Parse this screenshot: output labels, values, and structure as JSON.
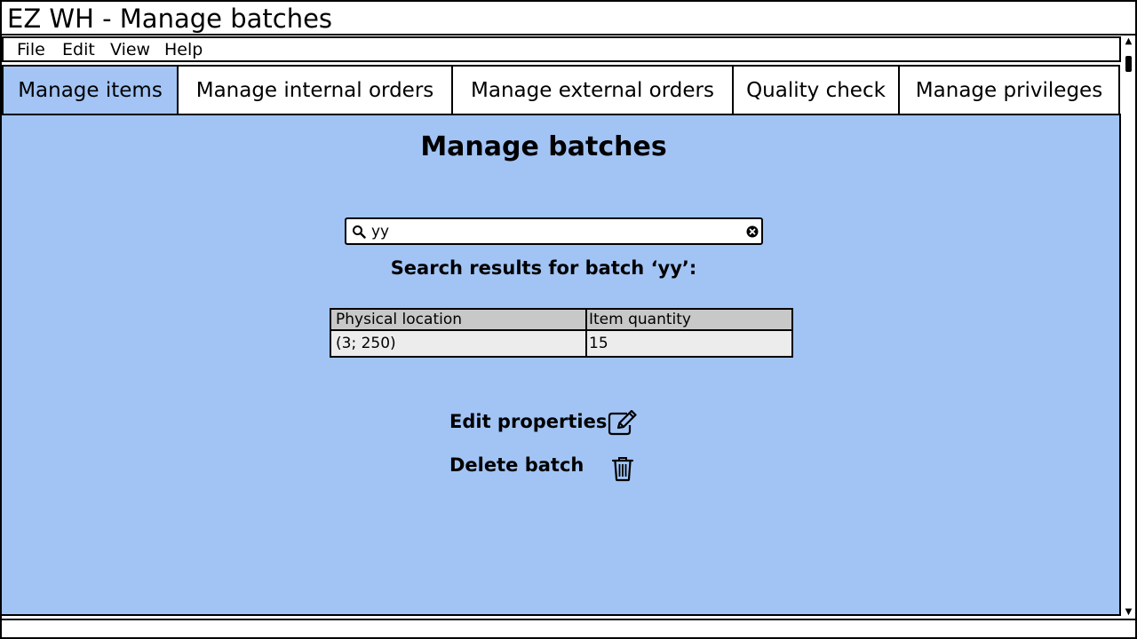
{
  "window": {
    "title": "EZ WH - Manage batches"
  },
  "menu": {
    "items": [
      {
        "label": "File"
      },
      {
        "label": "Edit"
      },
      {
        "label": "View"
      },
      {
        "label": "Help"
      }
    ]
  },
  "tabs": [
    {
      "label": "Manage items",
      "active": true
    },
    {
      "label": "Manage internal orders",
      "active": false
    },
    {
      "label": "Manage external orders",
      "active": false
    },
    {
      "label": "Quality check",
      "active": false
    },
    {
      "label": "Manage privileges",
      "active": false
    }
  ],
  "main": {
    "title": "Manage batches",
    "search": {
      "value": "yy",
      "search_icon": "search-icon",
      "clear_icon": "clear-icon"
    },
    "results_heading": "Search results for batch ‘yy’:",
    "table": {
      "columns": [
        "Physical location",
        "Item quantity"
      ],
      "rows": [
        [
          "(3; 250)",
          "15"
        ]
      ]
    },
    "actions": {
      "edit": {
        "label": "Edit properties",
        "icon": "edit-icon"
      },
      "delete": {
        "label": "Delete batch",
        "icon": "trash-icon"
      }
    }
  },
  "colors": {
    "content_background": "#a2c4f5",
    "active_tab": "#a3c4f4",
    "table_header": "#c8c8c8",
    "table_body": "#ececec"
  }
}
